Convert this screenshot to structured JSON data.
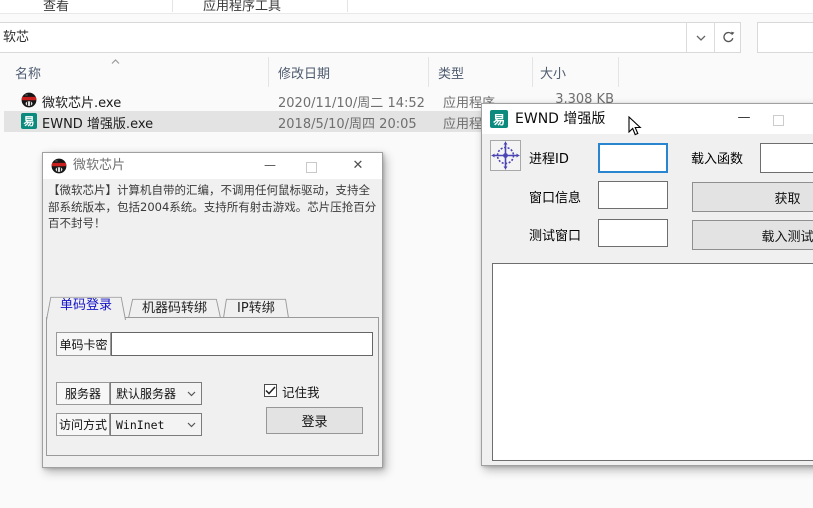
{
  "explorer": {
    "ribbon_tabs": [
      {
        "label": "查看"
      },
      {
        "label": "应用程序工具"
      }
    ],
    "address_text": "软芯",
    "search_value": "",
    "columns": {
      "name": "名称",
      "date": "修改日期",
      "type": "类型",
      "size": "大小"
    },
    "files": [
      {
        "name": "微软芯片.exe",
        "date": "2020/11/10/周二 14:52",
        "type": "应用程序",
        "size": "3,308 KB",
        "icon": "helmet-icon",
        "selected": false
      },
      {
        "name": "EWND 增强版.exe",
        "date": "2018/5/10/周四 20:05",
        "type": "应用程序",
        "icon": "easy-language-icon",
        "selected": true
      }
    ]
  },
  "chip_window": {
    "title": "微软芯片",
    "controls": {
      "minimize": "—",
      "close": "✕"
    },
    "description": "【微软芯片】计算机自带的汇编，不调用任何鼠标驱动，支持全\n部系统版本，包括2004系统。支持所有射击游戏。芯片压抢百分\n百不封号！",
    "tabs": [
      {
        "label": "单码登录",
        "active": true
      },
      {
        "label": "机器码转绑",
        "active": false
      },
      {
        "label": "IP转绑",
        "active": false
      }
    ],
    "card_label": "单码卡密",
    "card_value": "",
    "server_label": "服务器",
    "server_value": "默认服务器",
    "access_label": "访问方式",
    "access_value": "WinInet",
    "remember_label": "记住我",
    "remember_checked": true,
    "login_label": "登录"
  },
  "ewnd_window": {
    "title": "EWND 增强版",
    "controls": {
      "minimize": "—"
    },
    "icon_glyph": "易",
    "process_label": "进程ID",
    "process_value": "",
    "load_func_label": "载入函数",
    "load_func_value": "",
    "window_info_label": "窗口信息",
    "window_info_value": "",
    "get_button": "获取",
    "test_window_label": "测试窗口",
    "test_window_value": "",
    "load_test_button": "载入测试"
  },
  "colors": {
    "focus_border": "#2a85d0",
    "selection_bg": "#e3e3e3",
    "easy_language_teal": "#0b8a7e",
    "active_tab_text": "#1414c8"
  }
}
